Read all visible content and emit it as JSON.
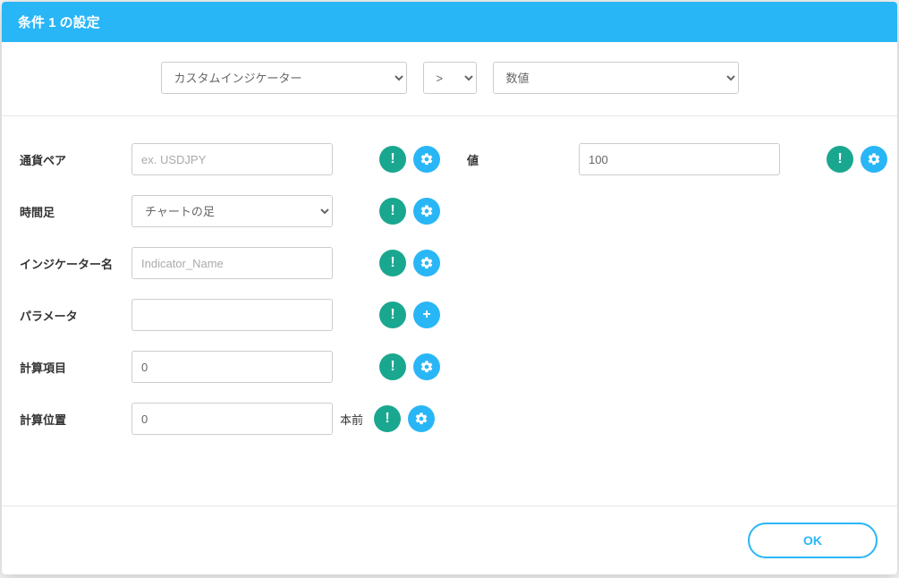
{
  "header": {
    "title": "条件 1 の設定"
  },
  "topSelects": {
    "left": "カスタムインジケーター",
    "operator": ">",
    "right": "数値"
  },
  "leftForm": {
    "currencyPair": {
      "label": "通貨ペア",
      "placeholder": "ex. USDJPY",
      "value": ""
    },
    "timeframe": {
      "label": "時間足",
      "selected": "チャートの足"
    },
    "indicatorName": {
      "label": "インジケーター名",
      "placeholder": "Indicator_Name",
      "value": ""
    },
    "parameter": {
      "label": "パラメータ",
      "value": ""
    },
    "calcItem": {
      "label": "計算項目",
      "value": "0"
    },
    "calcPosition": {
      "label": "計算位置",
      "value": "0",
      "suffix": "本前"
    }
  },
  "rightForm": {
    "value": {
      "label": "値",
      "value": "100"
    }
  },
  "footer": {
    "okLabel": "OK"
  }
}
